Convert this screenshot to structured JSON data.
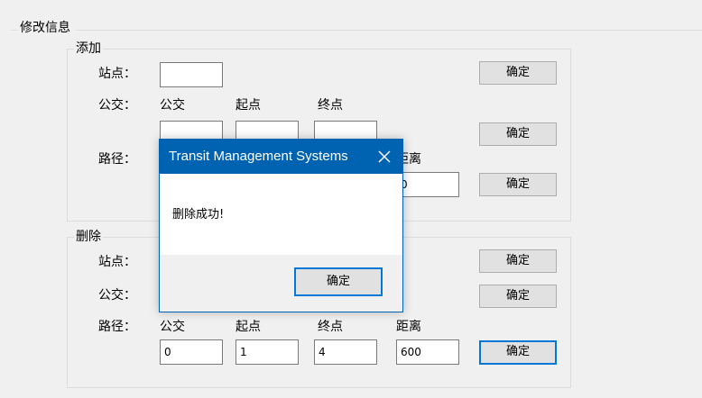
{
  "section_title": "修改信息",
  "add": {
    "legend": "添加",
    "station_label": "站点：",
    "bus_label": "公交：",
    "route_label": "路径：",
    "col_bus": "公交",
    "col_start": "起点",
    "col_end": "终点",
    "col_distance": "距离",
    "distance_value_partial": "0",
    "confirm": "确定"
  },
  "delete": {
    "legend": "删除",
    "station_label": "站点：",
    "bus_label": "公交：",
    "route_label": "路径：",
    "col_bus": "公交",
    "col_start": "起点",
    "col_end": "终点",
    "col_distance": "距离",
    "bus_value": "0",
    "start_value": "1",
    "end_value": "4",
    "distance_value": "600",
    "confirm": "确定"
  },
  "dialog": {
    "title": "Transit Management Systems",
    "message": "删除成功!",
    "ok": "确定",
    "close_icon": "close-icon",
    "accent": "#0063b1"
  }
}
